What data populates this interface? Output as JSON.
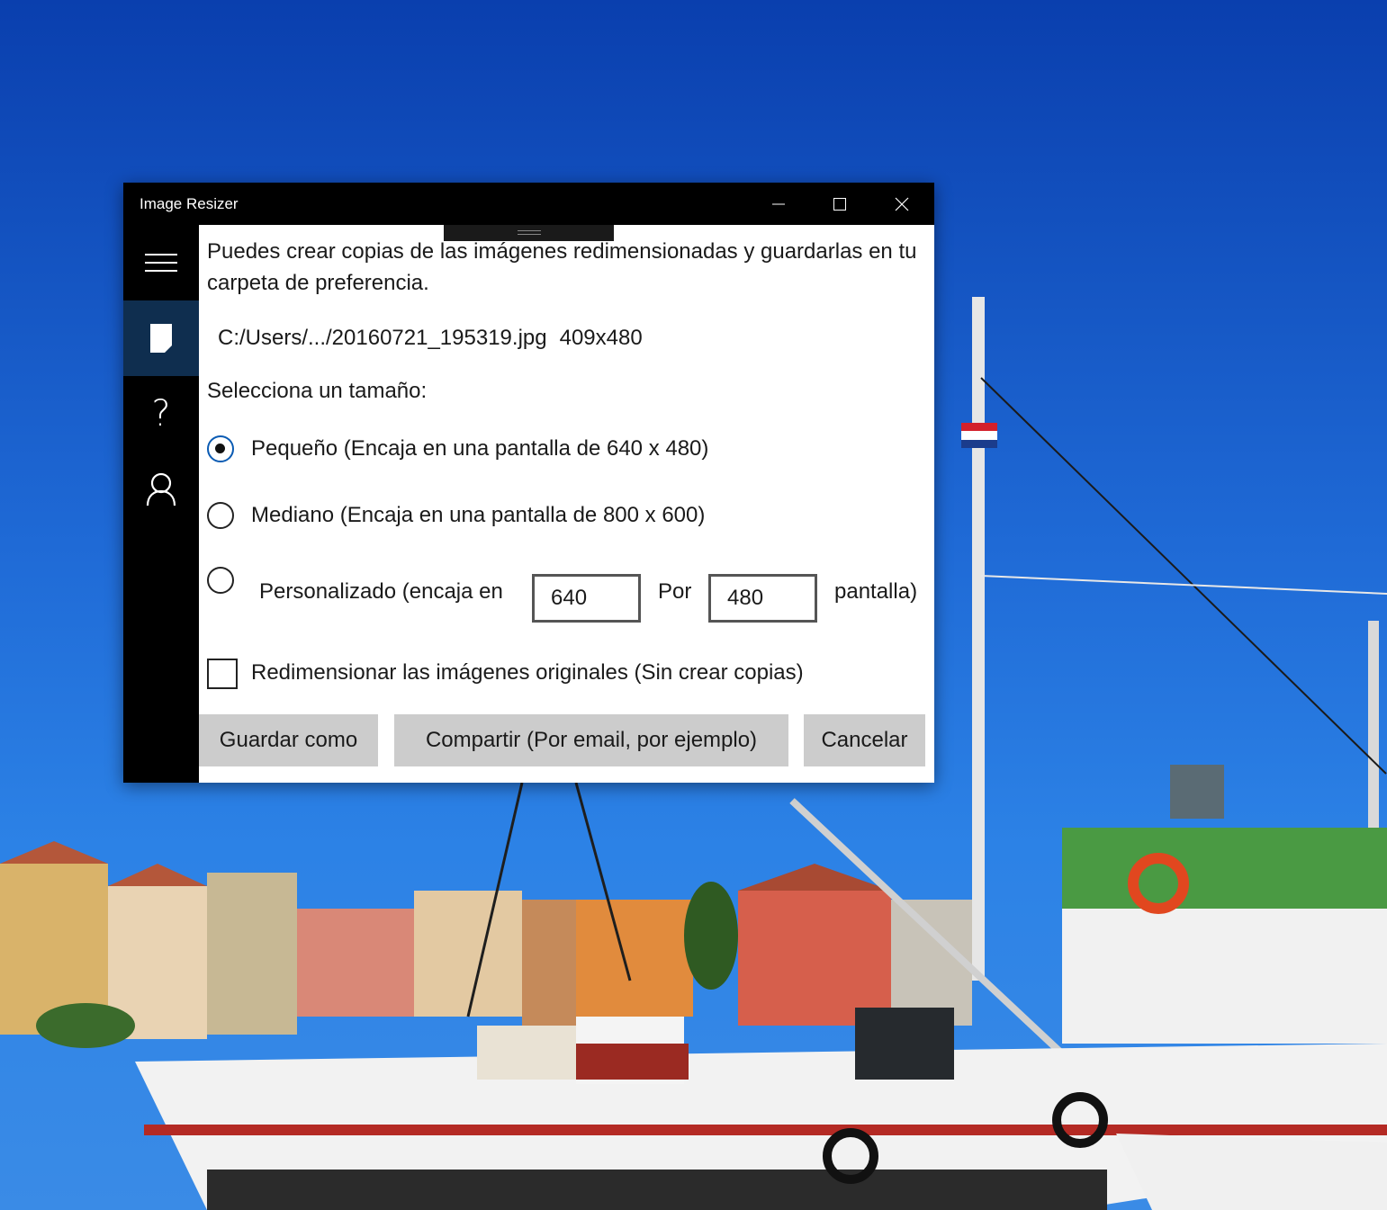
{
  "window": {
    "title": "Image Resizer",
    "controls": {
      "minimize_icon": "minimize-icon",
      "maximize_icon": "maximize-icon",
      "close_icon": "close-icon"
    }
  },
  "nav": {
    "items": [
      {
        "icon": "hamburger-menu-icon",
        "active": false
      },
      {
        "icon": "file-icon",
        "active": true
      },
      {
        "icon": "help-icon",
        "active": false
      },
      {
        "icon": "user-icon",
        "active": false
      }
    ]
  },
  "main": {
    "intro": "Puedes crear copias de las imágenes redimensionadas y guardarlas en tu carpeta de preferencia.",
    "file_path": "C:/Users/.../20160721_195319.jpg",
    "file_dims": "409x480",
    "select_label": "Selecciona un tamaño:",
    "options": {
      "small": {
        "label": "Pequeño (Encaja en una pantalla de 640 x 480)",
        "checked": true
      },
      "medium": {
        "label": "Mediano (Encaja en una pantalla de 800 x 600)",
        "checked": false
      },
      "custom": {
        "label": "Personalizado (encaja en",
        "width": "640",
        "by_label": "Por",
        "height": "480",
        "suffix": "pantalla)",
        "checked": false
      }
    },
    "resize_originals": {
      "label": "Redimensionar las imágenes originales (Sin crear copias)",
      "checked": false
    },
    "buttons": {
      "save": "Guardar como",
      "share": "Compartir (Por email, por ejemplo)",
      "cancel": "Cancelar"
    }
  },
  "colors": {
    "accent": "#0a5bb3",
    "nav_active": "#0f2e4f",
    "button_bg": "#cccccc",
    "sky": "#1f6ad6"
  }
}
